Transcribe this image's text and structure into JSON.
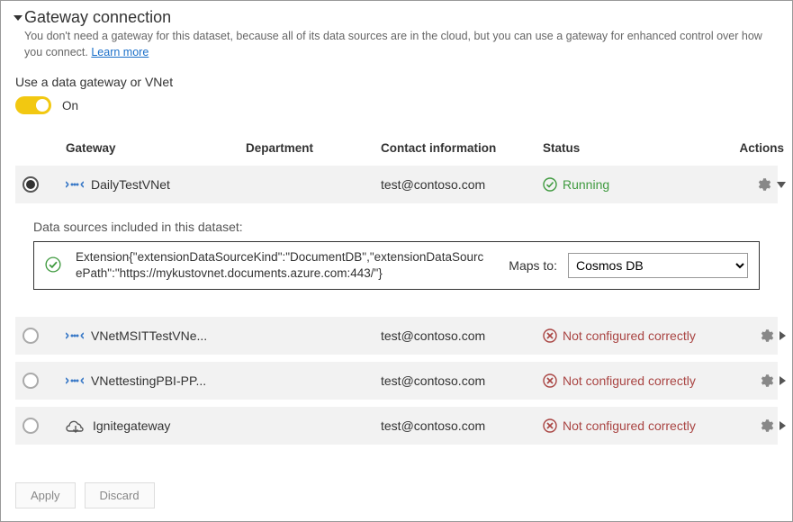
{
  "header": {
    "title": "Gateway connection",
    "description_prefix": "You don't need a gateway for this dataset, because all of its data sources are in the cloud, but you can use a gateway for enhanced control over how you connect. ",
    "learn_more": "Learn more"
  },
  "toggle": {
    "label": "Use a data gateway or VNet",
    "state_label": "On",
    "on": true
  },
  "columns": {
    "gateway": "Gateway",
    "department": "Department",
    "contact": "Contact information",
    "status": "Status",
    "actions": "Actions"
  },
  "datasources_block": {
    "title": "Data sources included in this dataset:",
    "extension_text": "Extension{\"extensionDataSourceKind\":\"DocumentDB\",\"extensionDataSourcePath\":\"https://mykustovnet.documents.azure.com:443/\"}",
    "maps_to_label": "Maps to:",
    "selected_option": "Cosmos DB"
  },
  "rows": [
    {
      "selected": true,
      "icon": "vnet-icon",
      "name": "DailyTestVNet",
      "department": "",
      "contact": "test@contoso.com",
      "status_kind": "running",
      "status_label": "Running",
      "expanded": true
    },
    {
      "selected": false,
      "icon": "vnet-icon",
      "name": "VNetMSITTestVNe...",
      "department": "",
      "contact": "test@contoso.com",
      "status_kind": "error",
      "status_label": "Not configured correctly",
      "expanded": false
    },
    {
      "selected": false,
      "icon": "vnet-icon",
      "name": "VNettestingPBI-PP...",
      "department": "",
      "contact": "test@contoso.com",
      "status_kind": "error",
      "status_label": "Not configured correctly",
      "expanded": false
    },
    {
      "selected": false,
      "icon": "cloud-gateway-icon",
      "name": "Ignitegateway",
      "department": "",
      "contact": "test@contoso.com",
      "status_kind": "error",
      "status_label": "Not configured correctly",
      "expanded": false
    }
  ],
  "buttons": {
    "apply": "Apply",
    "discard": "Discard"
  }
}
